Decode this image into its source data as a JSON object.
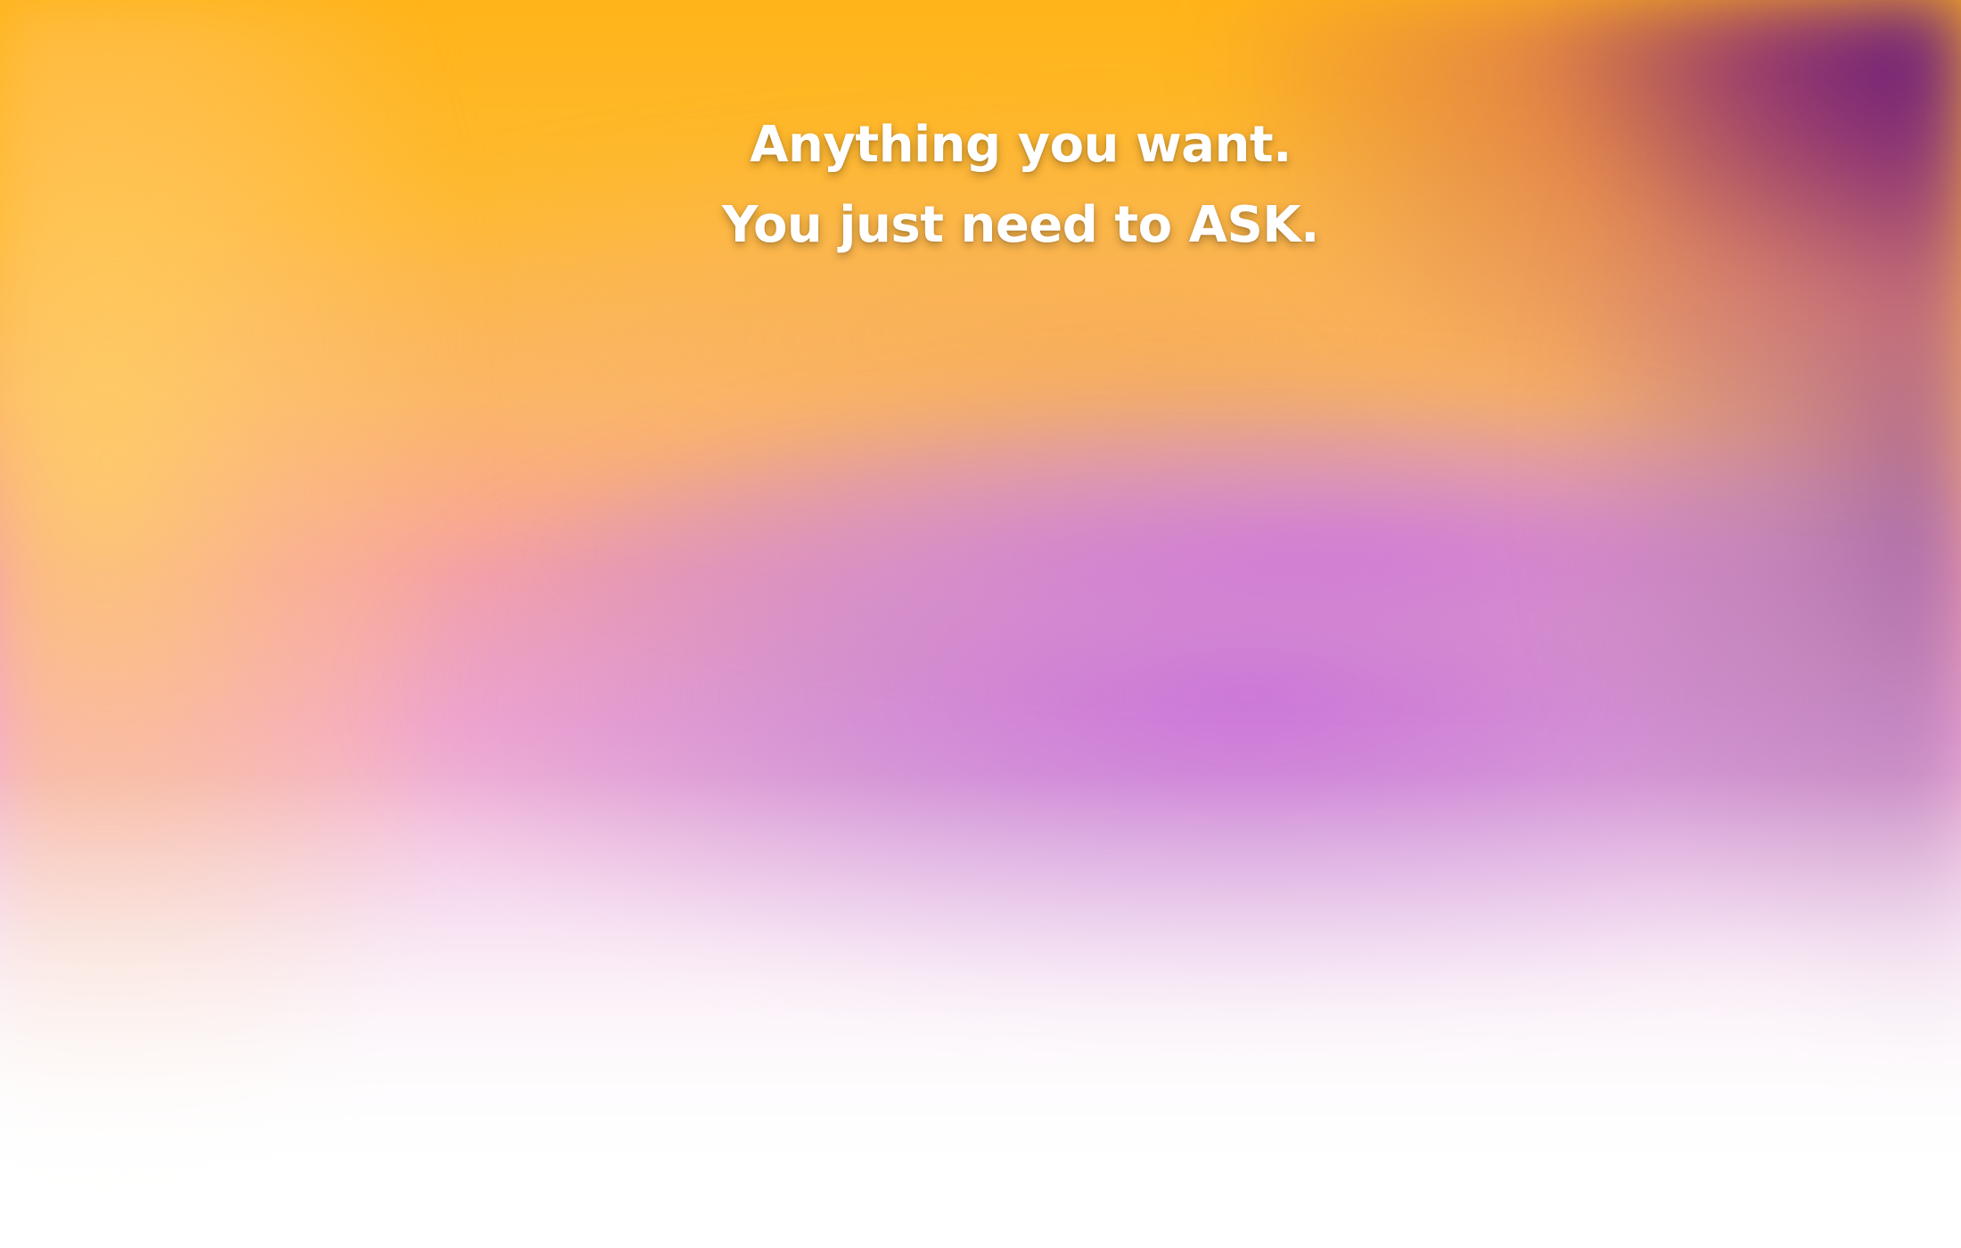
{
  "headline": {
    "line1": "Anything you want.",
    "line2": "You just need to ASK."
  },
  "colors": {
    "top_warm": "#ffb419",
    "top_right_purple": "#5a127d",
    "mid_violet": "#c46edc",
    "pink": "#f4a9cf",
    "bottom": "#ffffff",
    "text": "#ffffff"
  }
}
